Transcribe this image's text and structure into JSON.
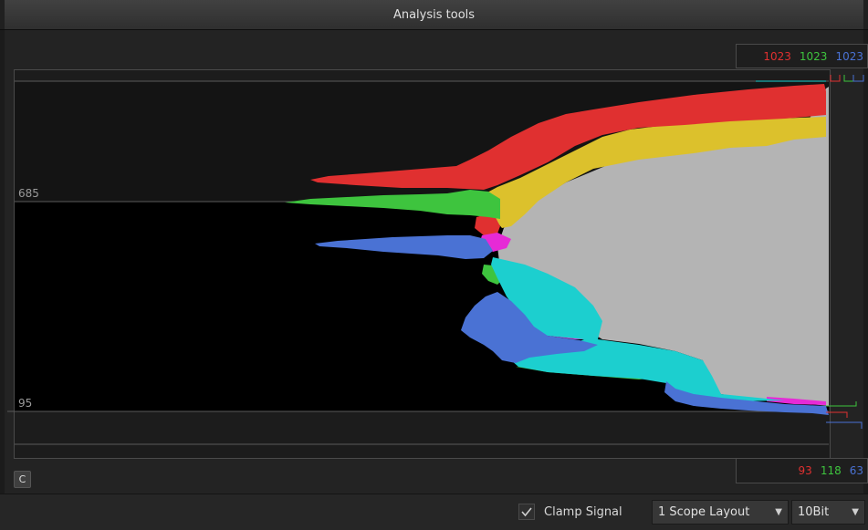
{
  "window": {
    "title": "Analysis tools"
  },
  "scope": {
    "top_values": {
      "red": "1023",
      "green": "1023",
      "blue": "1023"
    },
    "bottom_values": {
      "red": "93",
      "green": "118",
      "blue": "63"
    },
    "scale_labels": {
      "upper": "685",
      "lower": "95"
    },
    "colors": {
      "red": "#e03030",
      "green": "#3ec43e",
      "blue": "#4a72d4",
      "yellow": "#dcc12c",
      "cyan": "#1ccfcf",
      "magenta": "#e62ad6",
      "gray": "#b4b4b4"
    }
  },
  "controls": {
    "c_button_label": "C",
    "clamp_signal_label": "Clamp Signal",
    "clamp_signal_checked": true,
    "layout_select_value": "1 Scope Layout",
    "bitdepth_select_value": "10Bit"
  }
}
